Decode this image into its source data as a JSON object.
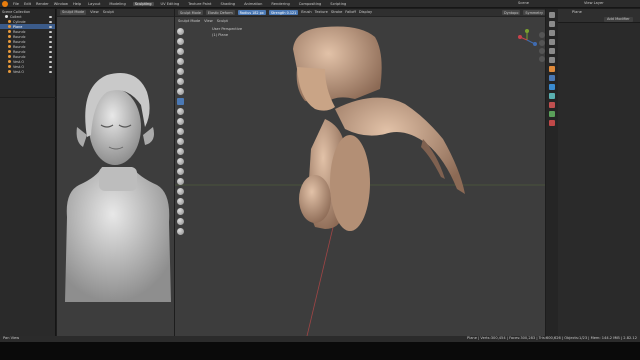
{
  "topbar": {
    "menus": [
      "File",
      "Edit",
      "Render",
      "Window",
      "Help"
    ],
    "workspaces": [
      "Layout",
      "Modeling",
      "Sculpting",
      "UV Editing",
      "Texture Paint",
      "Shading",
      "Animation",
      "Rendering",
      "Compositing",
      "Scripting"
    ],
    "active_workspace": "Sculpting",
    "scene": "Scene",
    "view_layer": "View Layer"
  },
  "outliner": {
    "rows": [
      {
        "label": "Scene Collection",
        "selected": false
      },
      {
        "label": "Collect",
        "selected": false
      },
      {
        "label": "Cylinde",
        "selected": false
      },
      {
        "label": "Plane",
        "selected": true
      },
      {
        "label": "Roundc",
        "selected": false
      },
      {
        "label": "Roundc",
        "selected": false
      },
      {
        "label": "Roundc",
        "selected": false
      },
      {
        "label": "Roundc",
        "selected": false
      },
      {
        "label": "Roundc",
        "selected": false
      },
      {
        "label": "Roundc",
        "selected": false
      },
      {
        "label": "Vest.O",
        "selected": false
      },
      {
        "label": "Vest.O",
        "selected": false
      },
      {
        "label": "Vest.O",
        "selected": false
      }
    ]
  },
  "left_viewport": {
    "mode": "Sculpt Mode",
    "menus": [
      "View",
      "Sculpt"
    ]
  },
  "tool_settings": {
    "brush": "Elastic Deform",
    "radius_label": "Radius",
    "radius_value": "182 px",
    "strength_label": "Strength",
    "strength_value": "0.121",
    "menus": [
      "Brush",
      "Texture",
      "Stroke",
      "Falloff",
      "Display"
    ],
    "dyntopo": "Dyntopo",
    "symmetry": "Symmetry"
  },
  "main_viewport": {
    "mode": "Sculpt Mode",
    "menus": [
      "View",
      "Sculpt"
    ],
    "overlay_line1": "User Perspective",
    "overlay_line2": "(1) Plane"
  },
  "properties": {
    "object_name": "Plane",
    "add_modifier": "Add Modifier"
  },
  "statusbar": {
    "left": "Pan View",
    "right": "Plane | Verts:300,454 | Faces:300,283 | Tris:600,626 | Objects:1/23 | Mem: 144.2 MiB | 2.82.12"
  },
  "colors": {
    "accent": "#4b79b5",
    "outliner_select": "#3b5b8a",
    "viewport_bg": "#3d3d3d",
    "mesh": "#d0d0d0",
    "skin": "#c49b7e"
  }
}
